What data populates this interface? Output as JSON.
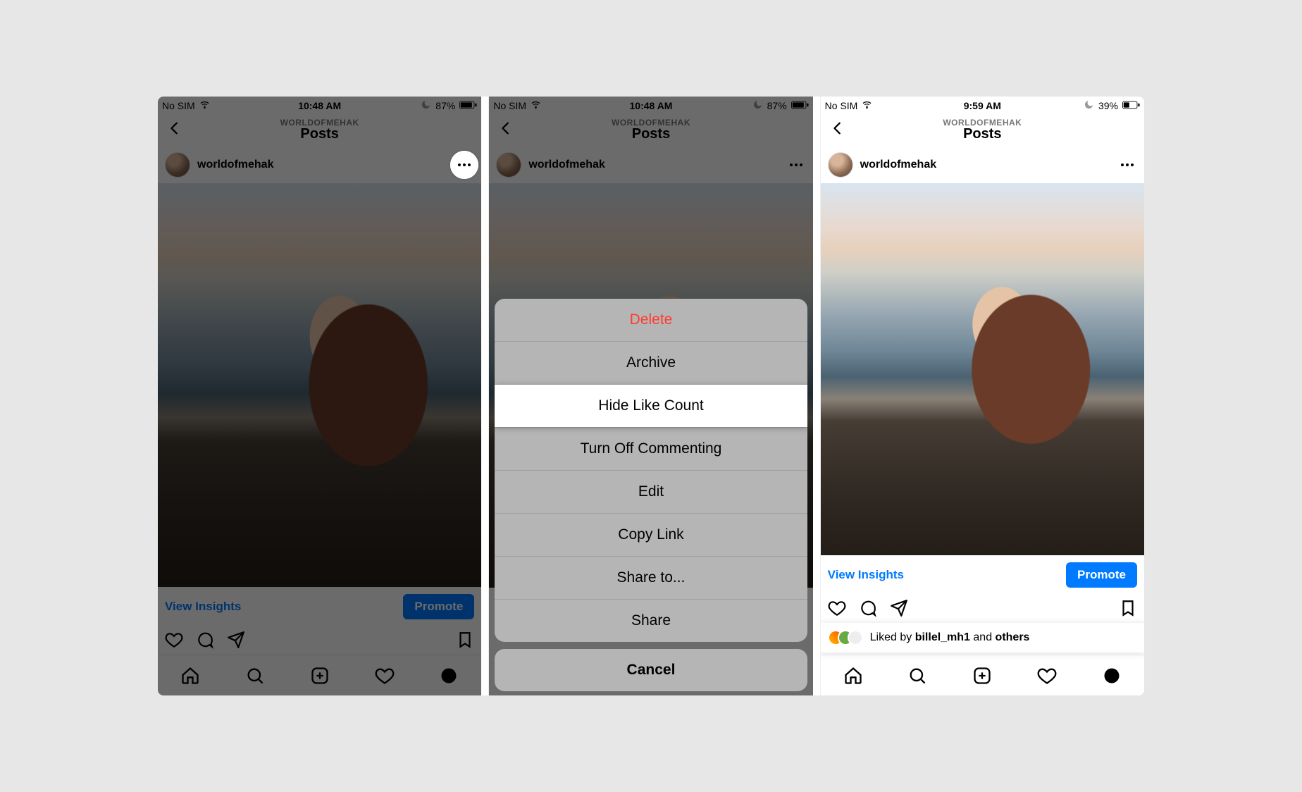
{
  "screens": [
    {
      "status": {
        "carrier": "No SIM",
        "time": "10:48 AM",
        "batteryText": "87%"
      },
      "header": {
        "subtitle": "WORLDOFMEHAK",
        "title": "Posts"
      },
      "post": {
        "username": "worldofmehak"
      },
      "insights": {
        "link": "View Insights",
        "promote": "Promote"
      }
    },
    {
      "status": {
        "carrier": "No SIM",
        "time": "10:48 AM",
        "batteryText": "87%"
      },
      "header": {
        "subtitle": "WORLDOFMEHAK",
        "title": "Posts"
      },
      "post": {
        "username": "worldofmehak"
      },
      "sheet": {
        "items": [
          {
            "label": "Delete",
            "destructive": true
          },
          {
            "label": "Archive"
          },
          {
            "label": "Hide Like Count",
            "highlight": true
          },
          {
            "label": "Turn Off Commenting"
          },
          {
            "label": "Edit"
          },
          {
            "label": "Copy Link"
          },
          {
            "label": "Share to..."
          },
          {
            "label": "Share"
          }
        ],
        "cancel": "Cancel"
      }
    },
    {
      "status": {
        "carrier": "No SIM",
        "time": "9:59 AM",
        "batteryText": "39%"
      },
      "header": {
        "subtitle": "WORLDOFMEHAK",
        "title": "Posts"
      },
      "post": {
        "username": "worldofmehak"
      },
      "insights": {
        "link": "View Insights",
        "promote": "Promote"
      },
      "likes": {
        "prefix": "Liked by ",
        "name": "billel_mh1",
        "middle": " and ",
        "others": "others"
      }
    }
  ]
}
